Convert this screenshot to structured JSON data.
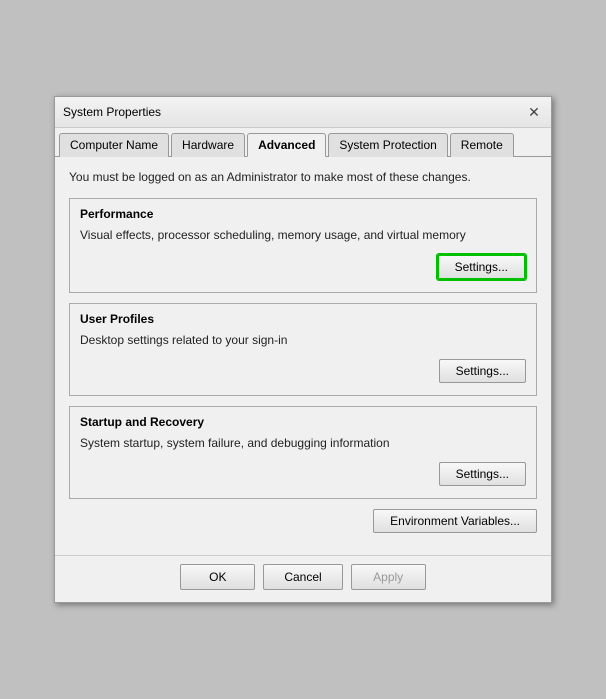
{
  "window": {
    "title": "System Properties",
    "close_label": "✕"
  },
  "tabs": [
    {
      "label": "Computer Name",
      "active": false
    },
    {
      "label": "Hardware",
      "active": false
    },
    {
      "label": "Advanced",
      "active": true
    },
    {
      "label": "System Protection",
      "active": false
    },
    {
      "label": "Remote",
      "active": false
    }
  ],
  "content": {
    "admin_notice": "You must be logged on as an Administrator to make most of these changes.",
    "performance": {
      "title": "Performance",
      "description": "Visual effects, processor scheduling, memory usage, and virtual memory",
      "settings_label": "Settings..."
    },
    "user_profiles": {
      "title": "User Profiles",
      "description": "Desktop settings related to your sign-in",
      "settings_label": "Settings..."
    },
    "startup_recovery": {
      "title": "Startup and Recovery",
      "description": "System startup, system failure, and debugging information",
      "settings_label": "Settings..."
    },
    "env_variables_label": "Environment Variables..."
  },
  "footer": {
    "ok_label": "OK",
    "cancel_label": "Cancel",
    "apply_label": "Apply"
  }
}
